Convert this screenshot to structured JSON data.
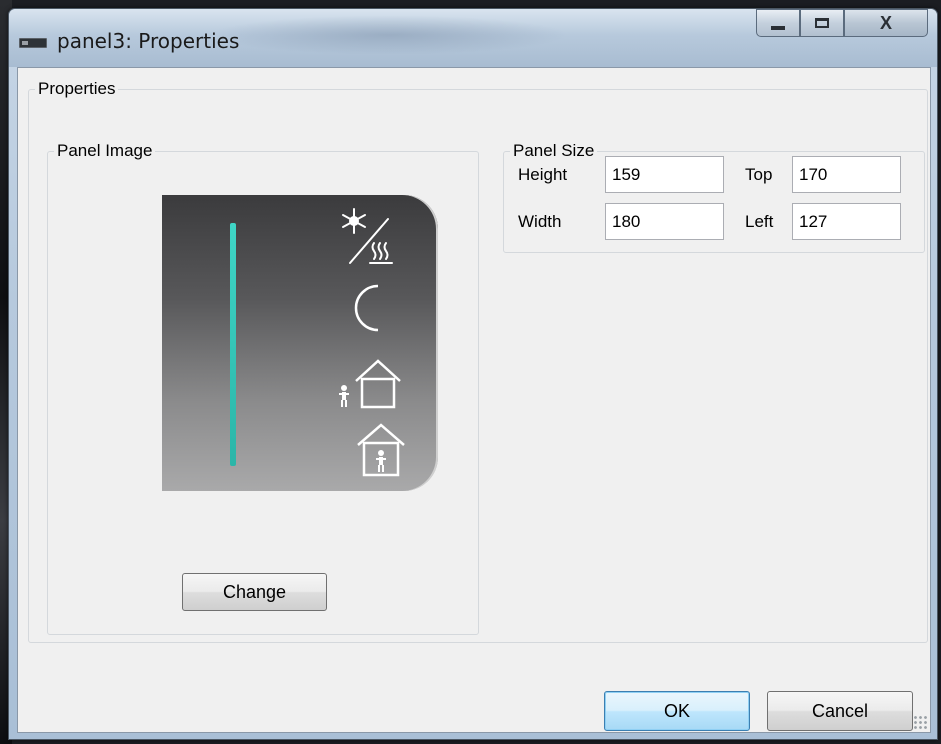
{
  "window": {
    "title": "panel3: Properties",
    "controls": {
      "minimize": "minimize",
      "maximize": "maximize",
      "close": "X"
    }
  },
  "properties_group": {
    "legend": "Properties"
  },
  "panel_image_group": {
    "legend": "Panel Image",
    "icons": [
      "snowflake-heat-icon",
      "moon-icon",
      "person-outside-house-icon",
      "person-inside-house-icon"
    ],
    "change_label": "Change"
  },
  "panel_size_group": {
    "legend": "Panel Size",
    "height_label": "Height",
    "height_value": "159",
    "width_label": "Width",
    "width_value": "180",
    "top_label": "Top",
    "top_value": "170",
    "left_label": "Left",
    "left_value": "127"
  },
  "buttons": {
    "ok": "OK",
    "cancel": "Cancel"
  },
  "colors": {
    "accent_bar": "#2fc3b4",
    "ok_border": "#3c7fb1",
    "client_bg": "#f0f0f0"
  }
}
